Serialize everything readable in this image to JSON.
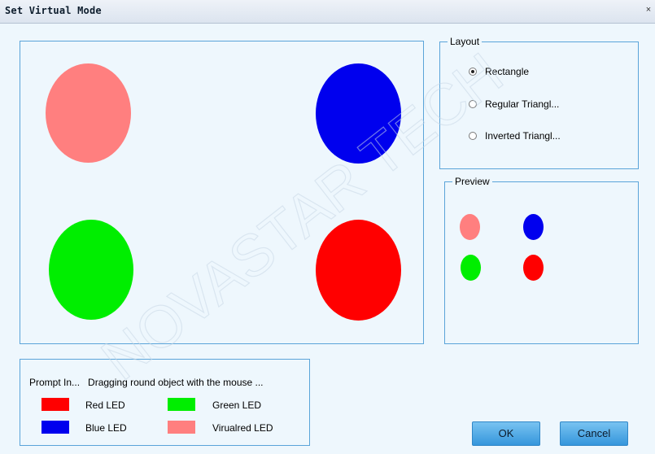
{
  "window": {
    "title": "Set Virtual Mode",
    "close_glyph": "×"
  },
  "canvas": {
    "circles": [
      {
        "name": "virtual-red-led-circle",
        "color": "#ff7f7f"
      },
      {
        "name": "blue-led-circle",
        "color": "#0000ee"
      },
      {
        "name": "green-led-circle",
        "color": "#00ee00"
      },
      {
        "name": "red-led-circle",
        "color": "#ff0000"
      }
    ]
  },
  "layout_group": {
    "label": "Layout",
    "options": [
      {
        "label": "Rectangle",
        "checked": true
      },
      {
        "label": "Regular Triangl...",
        "checked": false
      },
      {
        "label": "Inverted Triangl...",
        "checked": false
      }
    ]
  },
  "preview_group": {
    "label": "Preview",
    "dots": [
      "#ff7f7f",
      "#0000ee",
      "#00ee00",
      "#ff0000"
    ]
  },
  "prompt": {
    "title": "Prompt In...",
    "message": "Dragging round object with the mouse ...",
    "legend": [
      {
        "label": "Red LED",
        "color": "#ff0000"
      },
      {
        "label": "Green LED",
        "color": "#00ee00"
      },
      {
        "label": "Blue LED",
        "color": "#0000ee"
      },
      {
        "label": "Virualred LED",
        "color": "#ff7f7f"
      }
    ]
  },
  "buttons": {
    "ok": "OK",
    "cancel": "Cancel"
  },
  "watermark": "NOVASTAR TECH"
}
